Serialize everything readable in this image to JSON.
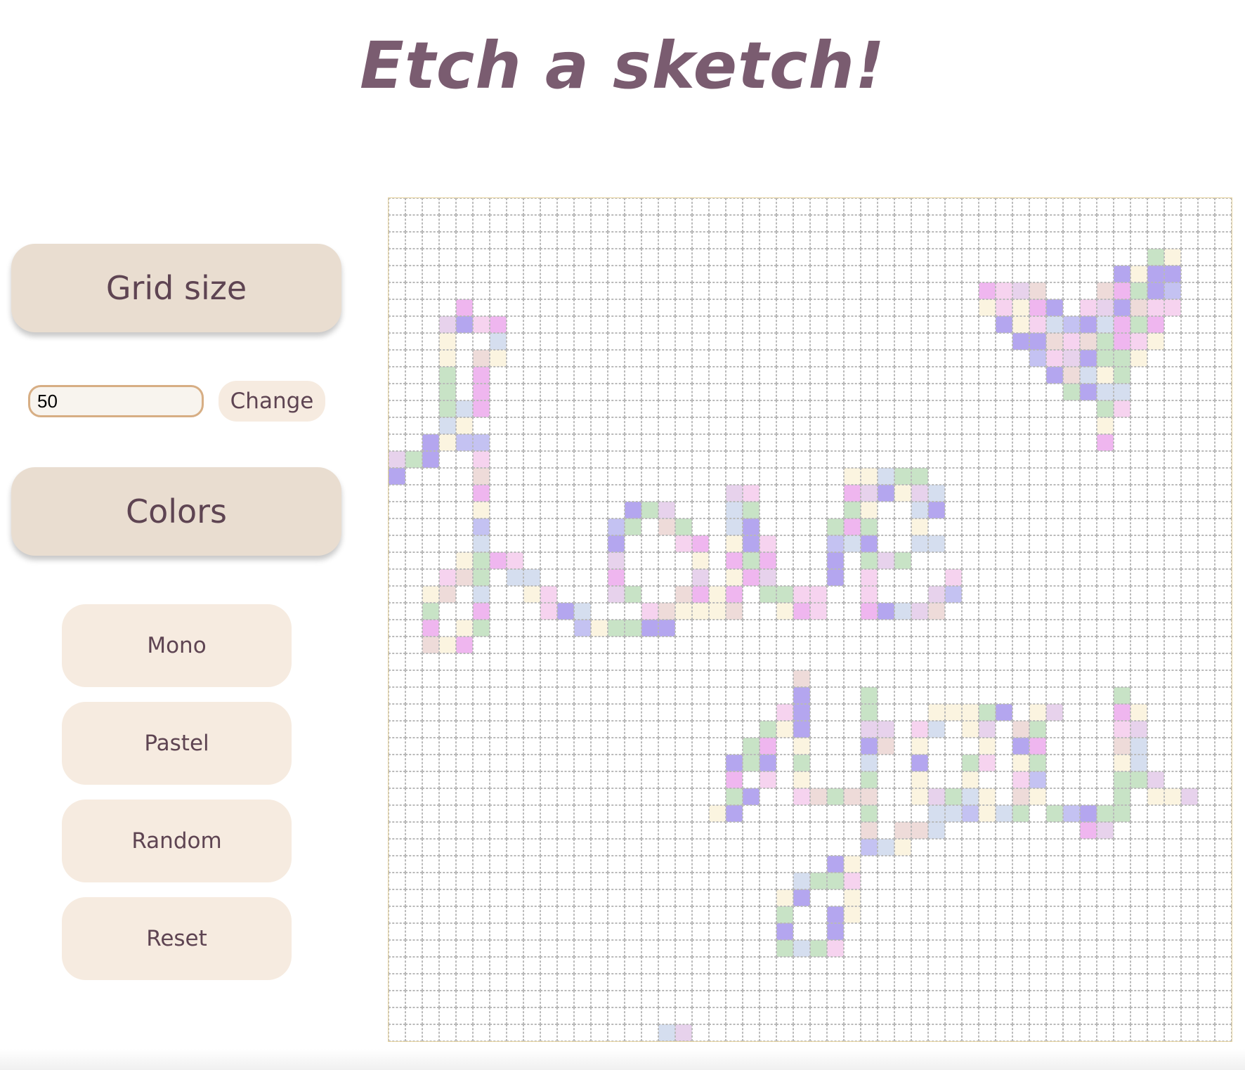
{
  "header": {
    "title": "Etch a sketch!"
  },
  "sidebar": {
    "grid_size_label": "Grid size",
    "grid_size_value": "50",
    "change_label": "Change",
    "colors_label": "Colors",
    "buttons": {
      "mono": "Mono",
      "pastel": "Pastel",
      "random": "Random",
      "reset": "Reset"
    }
  },
  "grid": {
    "size": 50,
    "palette": [
      "#b4a6ef",
      "#efb6ef",
      "#c8e3c6",
      "#f6d3ef",
      "#d5deef",
      "#fbf4e0",
      "#e7d2ec",
      "#eedbd9",
      "#c4c2f2"
    ],
    "painted": [
      [
        3,
        45,
        2
      ],
      [
        3,
        46,
        5
      ],
      [
        4,
        43,
        0
      ],
      [
        4,
        44,
        5
      ],
      [
        4,
        45,
        0
      ],
      [
        4,
        46,
        0
      ],
      [
        5,
        35,
        1
      ],
      [
        5,
        36,
        3
      ],
      [
        5,
        37,
        6
      ],
      [
        5,
        38,
        7
      ],
      [
        5,
        42,
        7
      ],
      [
        5,
        43,
        1
      ],
      [
        5,
        44,
        2
      ],
      [
        5,
        45,
        0
      ],
      [
        5,
        46,
        8
      ],
      [
        6,
        4,
        1
      ],
      [
        6,
        35,
        5
      ],
      [
        6,
        36,
        3
      ],
      [
        6,
        37,
        5
      ],
      [
        6,
        38,
        1
      ],
      [
        6,
        39,
        0
      ],
      [
        6,
        41,
        3
      ],
      [
        6,
        42,
        6
      ],
      [
        6,
        43,
        0
      ],
      [
        6,
        44,
        7
      ],
      [
        6,
        45,
        3
      ],
      [
        6,
        46,
        3
      ],
      [
        7,
        3,
        6
      ],
      [
        7,
        4,
        0
      ],
      [
        7,
        5,
        3
      ],
      [
        7,
        6,
        1
      ],
      [
        7,
        36,
        0
      ],
      [
        7,
        37,
        5
      ],
      [
        7,
        38,
        3
      ],
      [
        7,
        39,
        4
      ],
      [
        7,
        40,
        8
      ],
      [
        7,
        41,
        0
      ],
      [
        7,
        42,
        4
      ],
      [
        7,
        43,
        1
      ],
      [
        7,
        44,
        2
      ],
      [
        7,
        45,
        1
      ],
      [
        8,
        3,
        5
      ],
      [
        8,
        6,
        4
      ],
      [
        8,
        37,
        0
      ],
      [
        8,
        38,
        0
      ],
      [
        8,
        39,
        7
      ],
      [
        8,
        40,
        3
      ],
      [
        8,
        41,
        7
      ],
      [
        8,
        42,
        2
      ],
      [
        8,
        43,
        1
      ],
      [
        8,
        44,
        3
      ],
      [
        8,
        45,
        5
      ],
      [
        9,
        3,
        5
      ],
      [
        9,
        5,
        7
      ],
      [
        9,
        6,
        5
      ],
      [
        9,
        38,
        8
      ],
      [
        9,
        39,
        3
      ],
      [
        9,
        40,
        6
      ],
      [
        9,
        41,
        0
      ],
      [
        9,
        42,
        2
      ],
      [
        9,
        43,
        2
      ],
      [
        9,
        44,
        5
      ],
      [
        10,
        3,
        2
      ],
      [
        10,
        5,
        1
      ],
      [
        10,
        39,
        0
      ],
      [
        10,
        40,
        7
      ],
      [
        10,
        41,
        4
      ],
      [
        10,
        42,
        5
      ],
      [
        10,
        43,
        2
      ],
      [
        11,
        3,
        2
      ],
      [
        11,
        5,
        1
      ],
      [
        11,
        40,
        2
      ],
      [
        11,
        41,
        0
      ],
      [
        11,
        42,
        4
      ],
      [
        11,
        43,
        4
      ],
      [
        12,
        3,
        2
      ],
      [
        12,
        4,
        4
      ],
      [
        12,
        5,
        1
      ],
      [
        12,
        42,
        2
      ],
      [
        12,
        43,
        3
      ],
      [
        13,
        3,
        4
      ],
      [
        13,
        4,
        5
      ],
      [
        13,
        42,
        5
      ],
      [
        14,
        2,
        0
      ],
      [
        14,
        3,
        5
      ],
      [
        14,
        4,
        8
      ],
      [
        14,
        5,
        8
      ],
      [
        14,
        42,
        1
      ],
      [
        15,
        0,
        6
      ],
      [
        15,
        1,
        2
      ],
      [
        15,
        2,
        0
      ],
      [
        15,
        5,
        3
      ],
      [
        16,
        0,
        0
      ],
      [
        16,
        5,
        7
      ],
      [
        16,
        27,
        5
      ],
      [
        16,
        28,
        5
      ],
      [
        16,
        29,
        4
      ],
      [
        16,
        30,
        2
      ],
      [
        16,
        31,
        2
      ],
      [
        17,
        5,
        1
      ],
      [
        17,
        20,
        6
      ],
      [
        17,
        21,
        3
      ],
      [
        17,
        27,
        1
      ],
      [
        17,
        28,
        6
      ],
      [
        17,
        29,
        0
      ],
      [
        17,
        30,
        5
      ],
      [
        17,
        31,
        6
      ],
      [
        17,
        32,
        4
      ],
      [
        18,
        5,
        5
      ],
      [
        18,
        14,
        0
      ],
      [
        18,
        15,
        2
      ],
      [
        18,
        16,
        6
      ],
      [
        18,
        20,
        4
      ],
      [
        18,
        21,
        2
      ],
      [
        18,
        27,
        2
      ],
      [
        18,
        28,
        5
      ],
      [
        18,
        31,
        4
      ],
      [
        18,
        32,
        0
      ],
      [
        19,
        5,
        8
      ],
      [
        19,
        13,
        8
      ],
      [
        19,
        14,
        2
      ],
      [
        19,
        16,
        7
      ],
      [
        19,
        17,
        2
      ],
      [
        19,
        20,
        4
      ],
      [
        19,
        21,
        0
      ],
      [
        19,
        26,
        2
      ],
      [
        19,
        27,
        1
      ],
      [
        19,
        28,
        2
      ],
      [
        19,
        31,
        5
      ],
      [
        20,
        5,
        4
      ],
      [
        20,
        13,
        0
      ],
      [
        20,
        17,
        3
      ],
      [
        20,
        18,
        1
      ],
      [
        20,
        20,
        5
      ],
      [
        20,
        21,
        0
      ],
      [
        20,
        22,
        3
      ],
      [
        20,
        26,
        8
      ],
      [
        20,
        27,
        4
      ],
      [
        20,
        28,
        0
      ],
      [
        20,
        31,
        4
      ],
      [
        20,
        32,
        4
      ],
      [
        21,
        4,
        5
      ],
      [
        21,
        5,
        2
      ],
      [
        21,
        6,
        1
      ],
      [
        21,
        7,
        3
      ],
      [
        21,
        13,
        6
      ],
      [
        21,
        18,
        5
      ],
      [
        21,
        20,
        1
      ],
      [
        21,
        21,
        2
      ],
      [
        21,
        22,
        1
      ],
      [
        21,
        26,
        0
      ],
      [
        21,
        28,
        2
      ],
      [
        21,
        29,
        6
      ],
      [
        21,
        30,
        2
      ],
      [
        22,
        3,
        3
      ],
      [
        22,
        4,
        7
      ],
      [
        22,
        5,
        2
      ],
      [
        22,
        7,
        4
      ],
      [
        22,
        8,
        4
      ],
      [
        22,
        13,
        1
      ],
      [
        22,
        18,
        6
      ],
      [
        22,
        20,
        5
      ],
      [
        22,
        21,
        1
      ],
      [
        22,
        22,
        6
      ],
      [
        22,
        26,
        0
      ],
      [
        22,
        28,
        3
      ],
      [
        22,
        33,
        3
      ],
      [
        23,
        2,
        5
      ],
      [
        23,
        3,
        7
      ],
      [
        23,
        5,
        4
      ],
      [
        23,
        8,
        5
      ],
      [
        23,
        9,
        3
      ],
      [
        23,
        13,
        6
      ],
      [
        23,
        14,
        2
      ],
      [
        23,
        17,
        7
      ],
      [
        23,
        18,
        1
      ],
      [
        23,
        19,
        5
      ],
      [
        23,
        20,
        1
      ],
      [
        23,
        22,
        2
      ],
      [
        23,
        23,
        2
      ],
      [
        23,
        24,
        3
      ],
      [
        23,
        25,
        3
      ],
      [
        23,
        28,
        3
      ],
      [
        23,
        32,
        6
      ],
      [
        23,
        33,
        8
      ],
      [
        24,
        2,
        2
      ],
      [
        24,
        5,
        1
      ],
      [
        24,
        9,
        3
      ],
      [
        24,
        10,
        0
      ],
      [
        24,
        11,
        4
      ],
      [
        24,
        15,
        3
      ],
      [
        24,
        16,
        7
      ],
      [
        24,
        17,
        5
      ],
      [
        24,
        18,
        5
      ],
      [
        24,
        19,
        5
      ],
      [
        24,
        20,
        7
      ],
      [
        24,
        23,
        5
      ],
      [
        24,
        24,
        1
      ],
      [
        24,
        25,
        3
      ],
      [
        24,
        28,
        1
      ],
      [
        24,
        29,
        0
      ],
      [
        24,
        30,
        4
      ],
      [
        24,
        31,
        6
      ],
      [
        24,
        32,
        7
      ],
      [
        25,
        2,
        1
      ],
      [
        25,
        4,
        5
      ],
      [
        25,
        5,
        2
      ],
      [
        25,
        11,
        8
      ],
      [
        25,
        12,
        5
      ],
      [
        25,
        13,
        2
      ],
      [
        25,
        14,
        2
      ],
      [
        25,
        15,
        0
      ],
      [
        25,
        16,
        0
      ],
      [
        26,
        2,
        7
      ],
      [
        26,
        3,
        5
      ],
      [
        26,
        4,
        1
      ],
      [
        28,
        24,
        7
      ],
      [
        29,
        24,
        0
      ],
      [
        29,
        28,
        2
      ],
      [
        29,
        43,
        2
      ],
      [
        30,
        23,
        3
      ],
      [
        30,
        24,
        0
      ],
      [
        30,
        28,
        2
      ],
      [
        30,
        32,
        5
      ],
      [
        30,
        33,
        5
      ],
      [
        30,
        34,
        5
      ],
      [
        30,
        35,
        2
      ],
      [
        30,
        36,
        0
      ],
      [
        30,
        38,
        5
      ],
      [
        30,
        39,
        6
      ],
      [
        30,
        43,
        1
      ],
      [
        30,
        44,
        5
      ],
      [
        31,
        22,
        2
      ],
      [
        31,
        23,
        5
      ],
      [
        31,
        24,
        0
      ],
      [
        31,
        28,
        6
      ],
      [
        31,
        29,
        6
      ],
      [
        31,
        31,
        3
      ],
      [
        31,
        32,
        4
      ],
      [
        31,
        34,
        5
      ],
      [
        31,
        35,
        6
      ],
      [
        31,
        37,
        7
      ],
      [
        31,
        38,
        2
      ],
      [
        31,
        43,
        3
      ],
      [
        31,
        44,
        6
      ],
      [
        32,
        21,
        2
      ],
      [
        32,
        22,
        1
      ],
      [
        32,
        24,
        5
      ],
      [
        32,
        28,
        0
      ],
      [
        32,
        29,
        7
      ],
      [
        32,
        31,
        5
      ],
      [
        32,
        35,
        5
      ],
      [
        32,
        37,
        0
      ],
      [
        32,
        38,
        1
      ],
      [
        32,
        43,
        7
      ],
      [
        32,
        44,
        4
      ],
      [
        33,
        20,
        0
      ],
      [
        33,
        21,
        2
      ],
      [
        33,
        22,
        0
      ],
      [
        33,
        24,
        2
      ],
      [
        33,
        28,
        4
      ],
      [
        33,
        31,
        0
      ],
      [
        33,
        34,
        2
      ],
      [
        33,
        35,
        3
      ],
      [
        33,
        37,
        5
      ],
      [
        33,
        38,
        2
      ],
      [
        33,
        43,
        5
      ],
      [
        33,
        44,
        4
      ],
      [
        34,
        20,
        1
      ],
      [
        34,
        22,
        3
      ],
      [
        34,
        24,
        5
      ],
      [
        34,
        28,
        2
      ],
      [
        34,
        31,
        5
      ],
      [
        34,
        34,
        5
      ],
      [
        34,
        37,
        3
      ],
      [
        34,
        38,
        8
      ],
      [
        34,
        43,
        2
      ],
      [
        34,
        44,
        2
      ],
      [
        34,
        45,
        6
      ],
      [
        35,
        20,
        2
      ],
      [
        35,
        21,
        0
      ],
      [
        35,
        24,
        3
      ],
      [
        35,
        25,
        7
      ],
      [
        35,
        26,
        2
      ],
      [
        35,
        27,
        7
      ],
      [
        35,
        28,
        7
      ],
      [
        35,
        31,
        5
      ],
      [
        35,
        32,
        6
      ],
      [
        35,
        33,
        2
      ],
      [
        35,
        34,
        4
      ],
      [
        35,
        35,
        5
      ],
      [
        35,
        37,
        7
      ],
      [
        35,
        38,
        5
      ],
      [
        35,
        43,
        2
      ],
      [
        35,
        45,
        5
      ],
      [
        35,
        46,
        5
      ],
      [
        35,
        47,
        6
      ],
      [
        36,
        19,
        5
      ],
      [
        36,
        20,
        0
      ],
      [
        36,
        28,
        2
      ],
      [
        36,
        32,
        4
      ],
      [
        36,
        33,
        4
      ],
      [
        36,
        34,
        8
      ],
      [
        36,
        35,
        5
      ],
      [
        36,
        36,
        4
      ],
      [
        36,
        37,
        2
      ],
      [
        36,
        39,
        2
      ],
      [
        36,
        40,
        8
      ],
      [
        36,
        41,
        0
      ],
      [
        36,
        42,
        2
      ],
      [
        36,
        43,
        2
      ],
      [
        37,
        28,
        7
      ],
      [
        37,
        30,
        7
      ],
      [
        37,
        31,
        7
      ],
      [
        37,
        32,
        4
      ],
      [
        37,
        41,
        1
      ],
      [
        37,
        42,
        6
      ],
      [
        38,
        28,
        8
      ],
      [
        38,
        29,
        4
      ],
      [
        38,
        30,
        5
      ],
      [
        39,
        26,
        0
      ],
      [
        39,
        27,
        5
      ],
      [
        40,
        24,
        4
      ],
      [
        40,
        25,
        2
      ],
      [
        40,
        26,
        2
      ],
      [
        40,
        27,
        3
      ],
      [
        41,
        23,
        5
      ],
      [
        41,
        24,
        0
      ],
      [
        41,
        27,
        5
      ],
      [
        42,
        23,
        2
      ],
      [
        42,
        26,
        0
      ],
      [
        42,
        27,
        5
      ],
      [
        43,
        23,
        0
      ],
      [
        43,
        26,
        0
      ],
      [
        44,
        23,
        2
      ],
      [
        44,
        24,
        4
      ],
      [
        44,
        25,
        2
      ],
      [
        44,
        26,
        3
      ],
      [
        49,
        16,
        4
      ],
      [
        49,
        17,
        6
      ]
    ]
  }
}
